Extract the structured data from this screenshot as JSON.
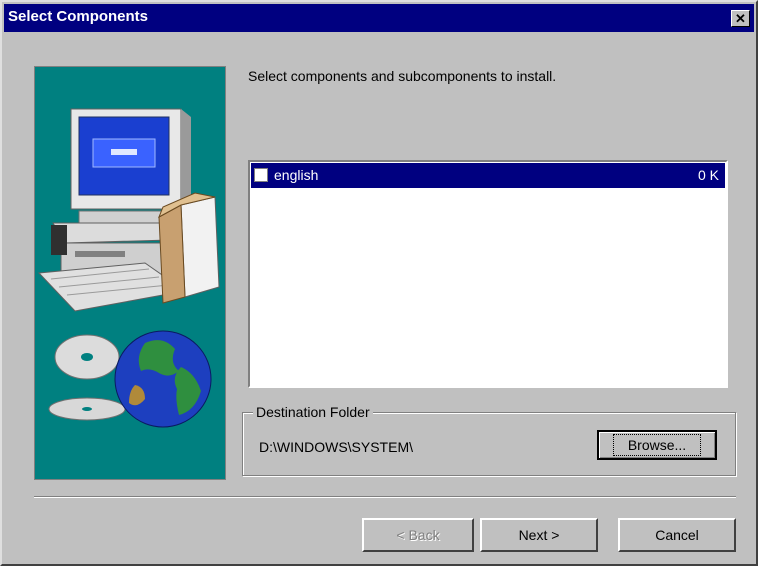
{
  "window": {
    "title": "Select Components",
    "close_glyph": "✕"
  },
  "instructions": "Select components and subcomponents to install.",
  "components": [
    {
      "name": "english",
      "size": "0 K",
      "checked": false,
      "selected": true
    }
  ],
  "destination": {
    "group_label": "Destination Folder",
    "path": "D:\\WINDOWS\\SYSTEM\\",
    "browse_label": "Browse..."
  },
  "buttons": {
    "back": {
      "label": "< Back",
      "enabled": false
    },
    "next": {
      "label": "Next >",
      "enabled": true
    },
    "cancel": {
      "label": "Cancel",
      "enabled": true
    }
  },
  "colors": {
    "title_bar": "#000080",
    "dialog_face": "#c0c0c0",
    "art_background": "#008080",
    "selection": "#000080"
  },
  "illustration": {
    "icons": [
      "computer-icon",
      "cd-disc-icon",
      "globe-icon"
    ]
  }
}
